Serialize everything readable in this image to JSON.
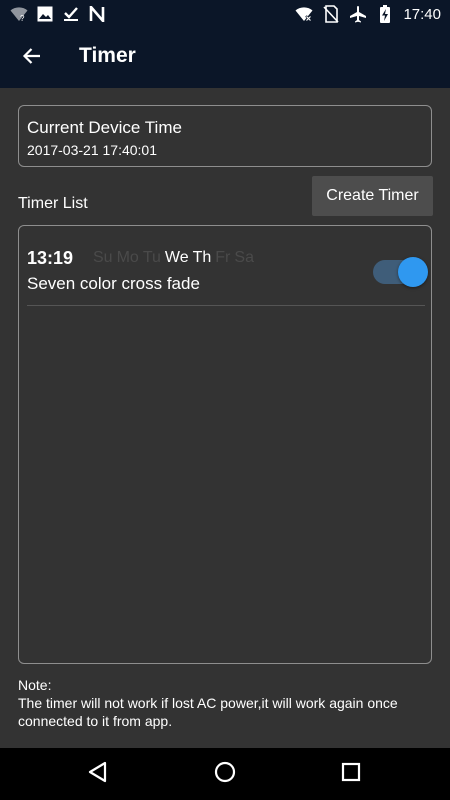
{
  "status_bar": {
    "left_icons": [
      "wifi-question-icon",
      "image-icon",
      "download-check-icon",
      "n-icon"
    ],
    "right_icons": [
      "wifi-x-icon",
      "no-sim-icon",
      "airplane-icon",
      "battery-charging-icon"
    ],
    "time": "17:40"
  },
  "app_bar": {
    "back_icon": "arrow-left-icon",
    "title": "Timer"
  },
  "device_time": {
    "label": "Current Device Time",
    "value": "2017-03-21 17:40:01"
  },
  "timer_list": {
    "label": "Timer List",
    "create_button": "Create Timer",
    "items": [
      {
        "time": "13:19",
        "days": [
          {
            "label": "Su",
            "active": false
          },
          {
            "label": "Mo",
            "active": false
          },
          {
            "label": "Tu",
            "active": false
          },
          {
            "label": "We",
            "active": true
          },
          {
            "label": "Th",
            "active": true
          },
          {
            "label": "Fr",
            "active": false
          },
          {
            "label": "Sa",
            "active": false
          }
        ],
        "mode": "Seven color cross fade",
        "enabled": true
      }
    ]
  },
  "note": {
    "title": "Note:",
    "text": "The timer will not work if lost AC power,it will work again once connected to it from app."
  },
  "colors": {
    "app_bar": "#0b1628",
    "background": "#333333",
    "toggle_knob": "#2f98f0",
    "toggle_track": "#3f5d79",
    "inactive_day": "#4a4a4a"
  },
  "nav_bar": {
    "icons": [
      "back-triangle-icon",
      "home-circle-icon",
      "recents-square-icon"
    ]
  }
}
